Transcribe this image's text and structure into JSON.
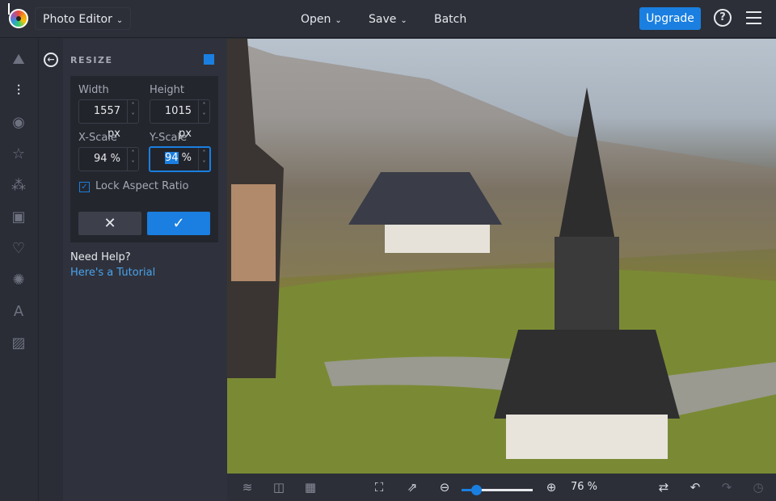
{
  "topbar": {
    "app_menu": "Photo Editor",
    "open": "Open",
    "save": "Save",
    "batch": "Batch",
    "upgrade": "Upgrade",
    "help": "?"
  },
  "rail": {
    "icons": [
      "image-icon",
      "adjust-icon",
      "eye-icon",
      "star-icon",
      "effects-icon",
      "frame-icon",
      "heart-icon",
      "badge-icon",
      "text-icon",
      "texture-icon"
    ]
  },
  "panel": {
    "title": "RESIZE",
    "width_label": "Width",
    "width_value": "1557",
    "width_unit": "px",
    "height_label": "Height",
    "height_value": "1015",
    "height_unit": "px",
    "xscale_label": "X-Scale",
    "xscale_value": "94",
    "yscale_label": "Y-Scale",
    "yscale_value": "94",
    "percent": "%",
    "lock_label": "Lock Aspect Ratio",
    "lock_checked": true,
    "need_help": "Need Help?",
    "tutorial": "Here's a Tutorial"
  },
  "bottombar": {
    "zoom": "76 %",
    "zoom_fraction": 0.2
  },
  "colors": {
    "accent": "#1a7fe0"
  }
}
